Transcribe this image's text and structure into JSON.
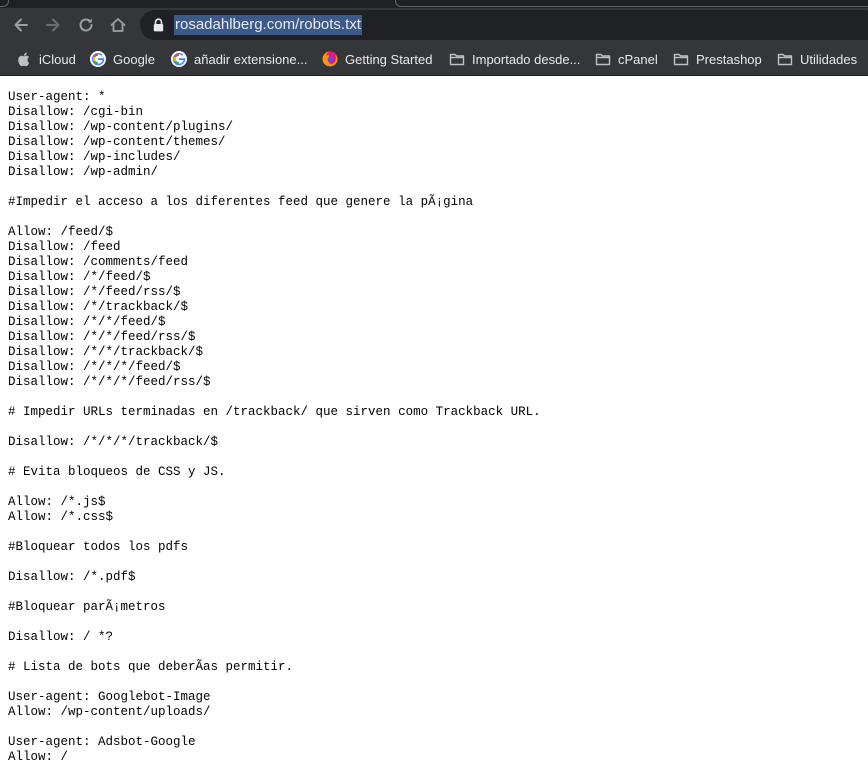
{
  "browser": {
    "url": "rosadahlberg.com/robots.txt",
    "icons": {
      "back": "arrow-left-icon",
      "forward": "arrow-right-icon",
      "reload": "reload-icon",
      "home": "home-icon",
      "security": "lock-icon"
    },
    "colors": {
      "frame": "#202124",
      "toolbar": "#35363a",
      "url_highlight": "#3b5a89",
      "text": "#e8eaed"
    }
  },
  "bookmarks": [
    {
      "label": "iCloud",
      "icon": "apple-icon"
    },
    {
      "label": "Google",
      "icon": "google-icon"
    },
    {
      "label": "añadir extensione...",
      "icon": "google-icon"
    },
    {
      "label": "Getting Started",
      "icon": "firefox-icon"
    },
    {
      "label": "Importado desde...",
      "icon": "folder-icon"
    },
    {
      "label": "cPanel",
      "icon": "folder-icon"
    },
    {
      "label": "Prestashop",
      "icon": "folder-icon"
    },
    {
      "label": "Utilidades",
      "icon": "folder-icon"
    }
  ],
  "document": {
    "text": "User-agent: *\nDisallow: /cgi-bin\nDisallow: /wp-content/plugins/\nDisallow: /wp-content/themes/\nDisallow: /wp-includes/\nDisallow: /wp-admin/\n\n#Impedir el acceso a los diferentes feed que genere la pÃ¡gina\n\nAllow: /feed/$\nDisallow: /feed\nDisallow: /comments/feed\nDisallow: /*/feed/$\nDisallow: /*/feed/rss/$\nDisallow: /*/trackback/$\nDisallow: /*/*/feed/$\nDisallow: /*/*/feed/rss/$\nDisallow: /*/*/trackback/$\nDisallow: /*/*/*/feed/$\nDisallow: /*/*/*/feed/rss/$\n\n# Impedir URLs terminadas en /trackback/ que sirven como Trackback URL.\n\nDisallow: /*/*/*/trackback/$\n\n# Evita bloqueos de CSS y JS.\n\nAllow: /*.js$\nAllow: /*.css$\n\n#Bloquear todos los pdfs\n\nDisallow: /*.pdf$\n\n#Bloquear parÃ¡metros\n\nDisallow: / *?\n\n# Lista de bots que deberÃ­as permitir.\n\nUser-agent: Googlebot-Image\nAllow: /wp-content/uploads/\n\nUser-agent: Adsbot-Google\nAllow: /"
  }
}
